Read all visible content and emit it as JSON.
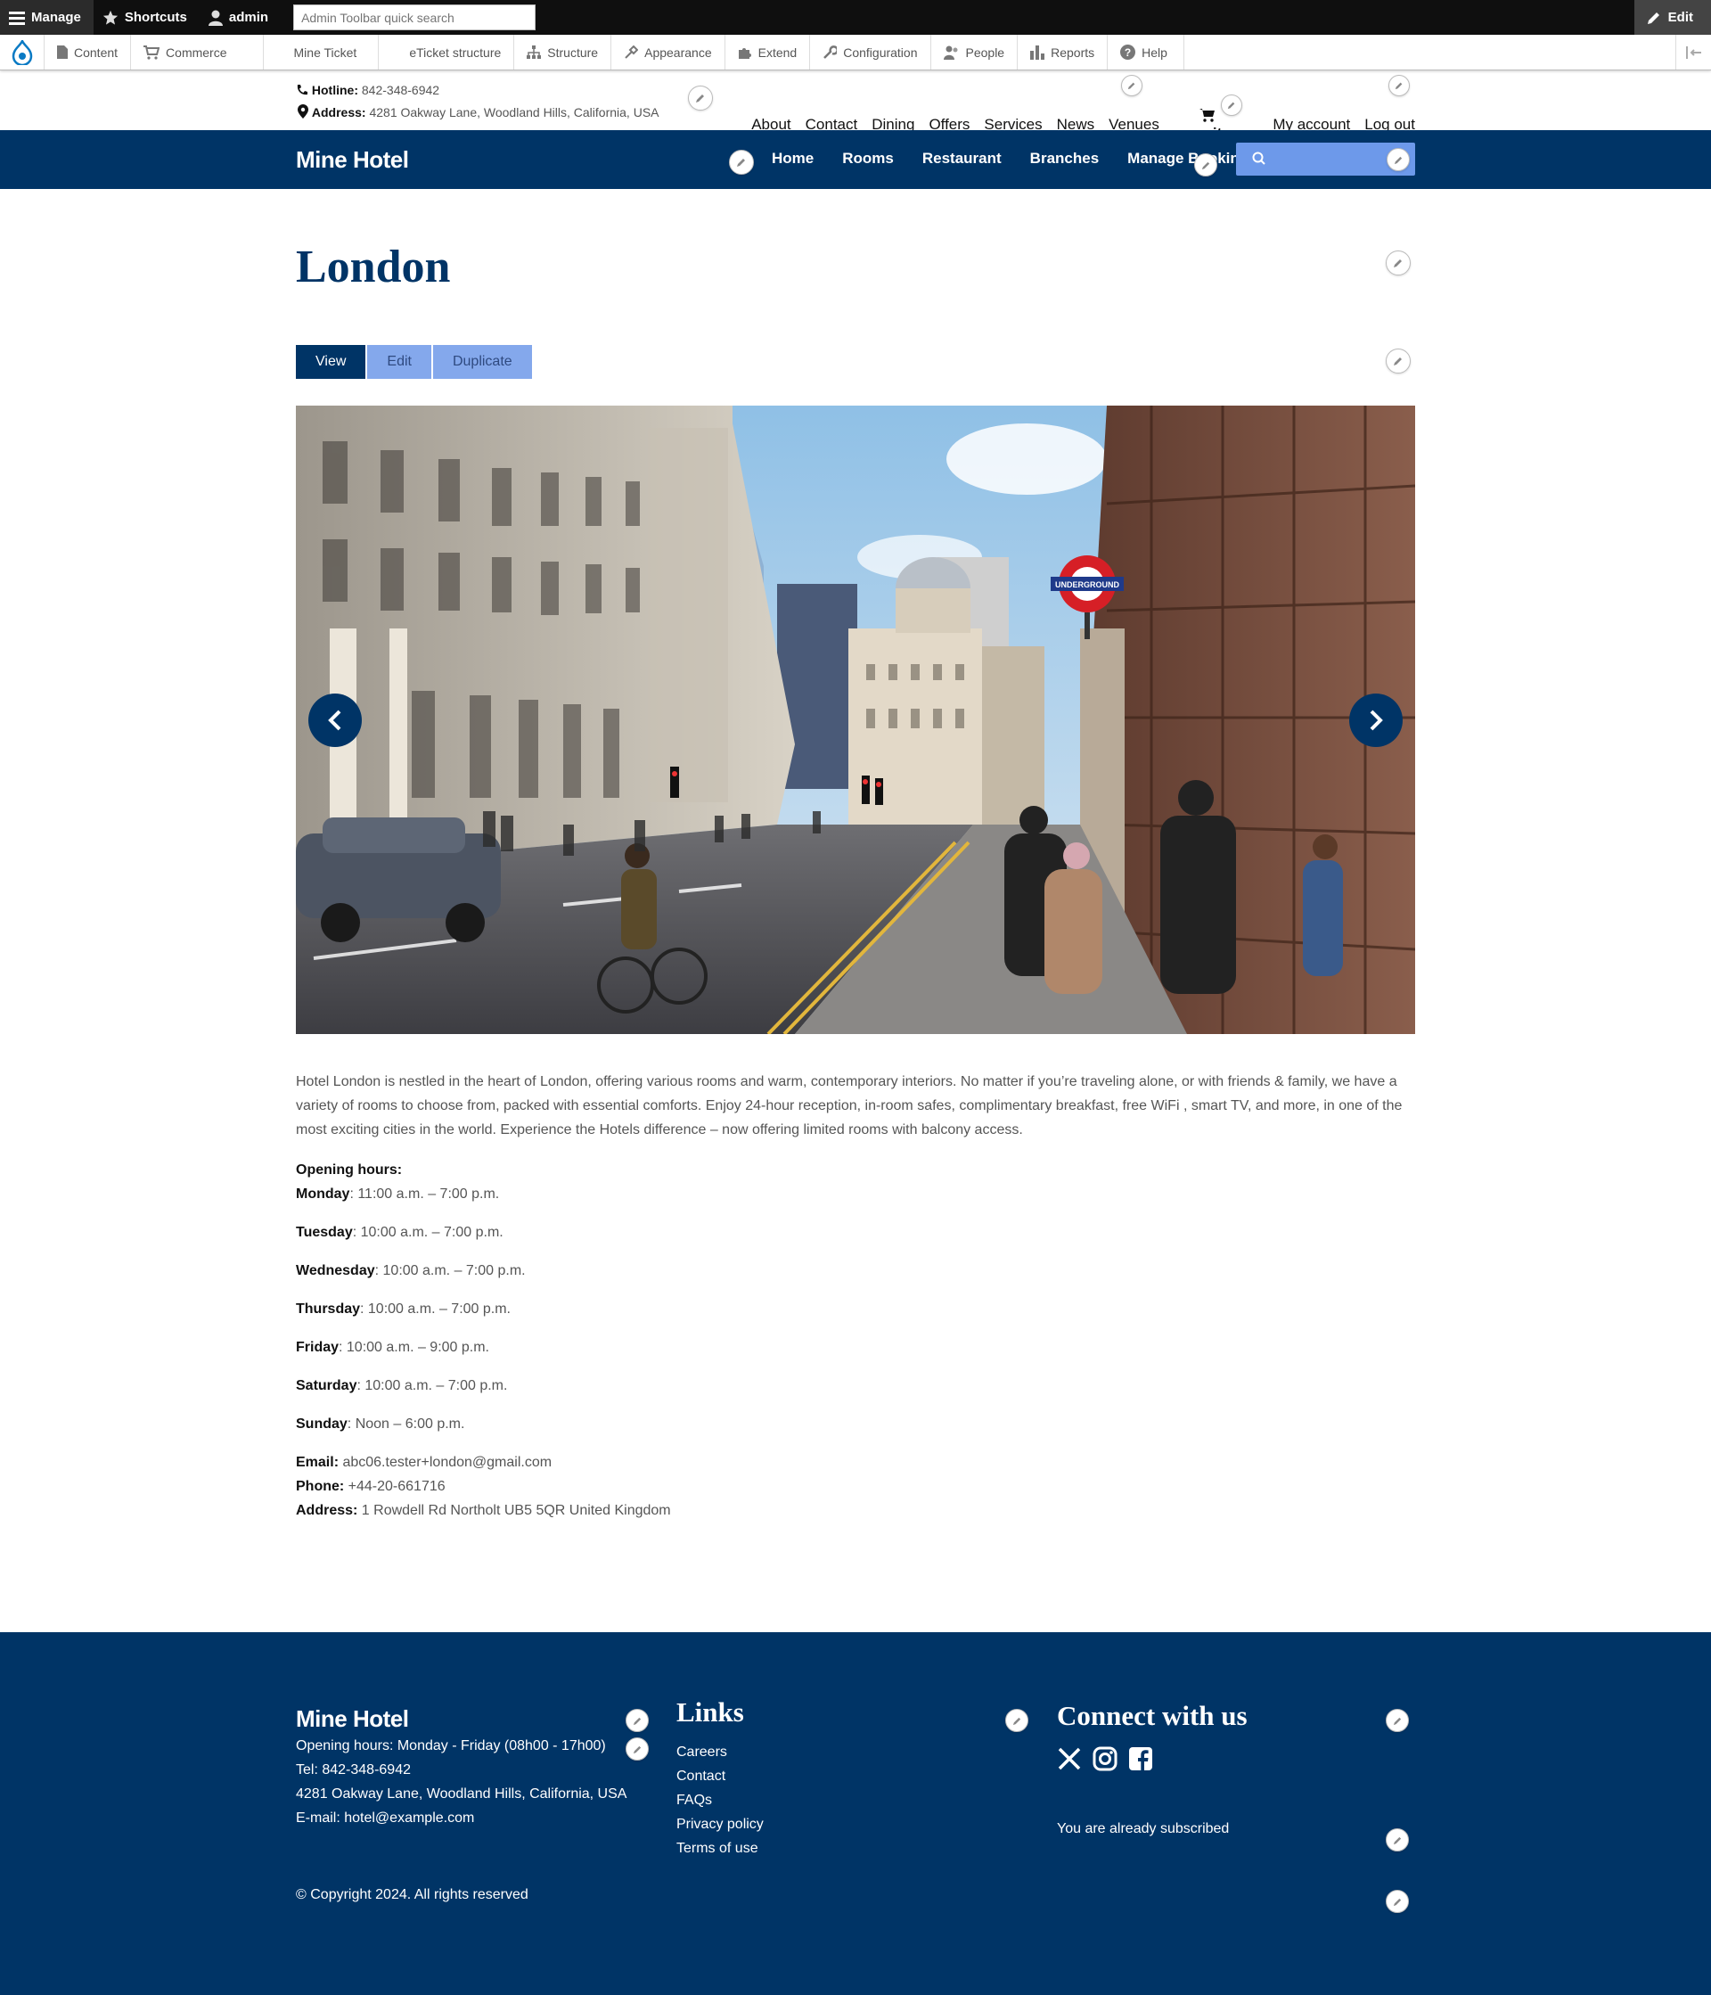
{
  "admin_toolbar": {
    "manage": "Manage",
    "shortcuts": "Shortcuts",
    "user": "admin",
    "search_placeholder": "Admin Toolbar quick search",
    "edit": "Edit"
  },
  "admin_tray": {
    "items": [
      "Content",
      "Commerce",
      "Mine Ticket",
      "eTicket structure",
      "Structure",
      "Appearance",
      "Extend",
      "Configuration",
      "People",
      "Reports",
      "Help"
    ]
  },
  "top_info": {
    "hotline_label": "Hotline:",
    "hotline": "842-348-6942",
    "address_label": "Address:",
    "address": "4281 Oakway Lane, Woodland Hills, California, USA"
  },
  "top_nav": {
    "items": [
      "About",
      "Contact",
      "Dining",
      "Offers",
      "Services",
      "News",
      "Venues"
    ],
    "cart": "o it     s",
    "account": "My account",
    "logout": "Log out"
  },
  "header": {
    "brand": "Mine Hotel",
    "nav": [
      "Home",
      "Rooms",
      "Restaurant",
      "Branches",
      "Manage Booking"
    ]
  },
  "page": {
    "title": "London",
    "tabs": [
      "View",
      "Edit",
      "Duplicate"
    ],
    "description": "Hotel London is nestled in the heart of London, offering various rooms and warm, contemporary interiors. No matter if you’re traveling alone, or with friends & family, we have a variety of rooms to choose from, packed with essential comforts. Enjoy 24-hour reception, in-room safes, complimentary breakfast, free WiFi , smart TV, and more, in one of the most exciting cities in the world. Experience the Hotels difference – now offering limited rooms with balcony access.",
    "opening_hours_label": "Opening hours:",
    "hours": [
      {
        "day": "Monday",
        "time": ": 11:00 a.m. – 7:00 p.m."
      },
      {
        "day": "Tuesday",
        "time": ": 10:00 a.m. – 7:00 p.m."
      },
      {
        "day": "Wednesday",
        "time": ": 10:00 a.m. – 7:00 p.m."
      },
      {
        "day": "Thursday",
        "time": ": 10:00 a.m. – 7:00 p.m."
      },
      {
        "day": "Friday",
        "time": ": 10:00 a.m. – 9:00 p.m."
      },
      {
        "day": "Saturday",
        "time": ": 10:00 a.m. – 7:00 p.m."
      },
      {
        "day": "Sunday",
        "time": ": Noon – 6:00 p.m."
      }
    ],
    "email_label": "Email:",
    "email": " abc06.tester+london@gmail.com",
    "phone_label": "Phone:",
    "phone": " +44-20-661716",
    "address_label": "Address:",
    "address": " 1 Rowdell Rd Northolt UB5 5QR United Kingdom",
    "sign_text": "UNDERGROUND"
  },
  "footer": {
    "brand": "Mine Hotel",
    "lines": [
      "Opening hours: Monday - Friday (08h00 - 17h00)",
      "Tel: 842-348-6942",
      "4281 Oakway Lane, Woodland Hills, California, USA",
      "E-mail: hotel@example.com"
    ],
    "links_heading": "Links",
    "links": [
      "Careers",
      "Contact",
      "FAQs",
      "Privacy policy",
      "Terms of use"
    ],
    "connect_heading": "Connect with us",
    "subscribed": "You are already subscribed",
    "copyright": "© Copyright 2024. All rights reserved"
  },
  "colors": {
    "brand_navy": "#003466",
    "tab_inactive": "#84a8ec",
    "search_blue": "#6d99ea"
  }
}
